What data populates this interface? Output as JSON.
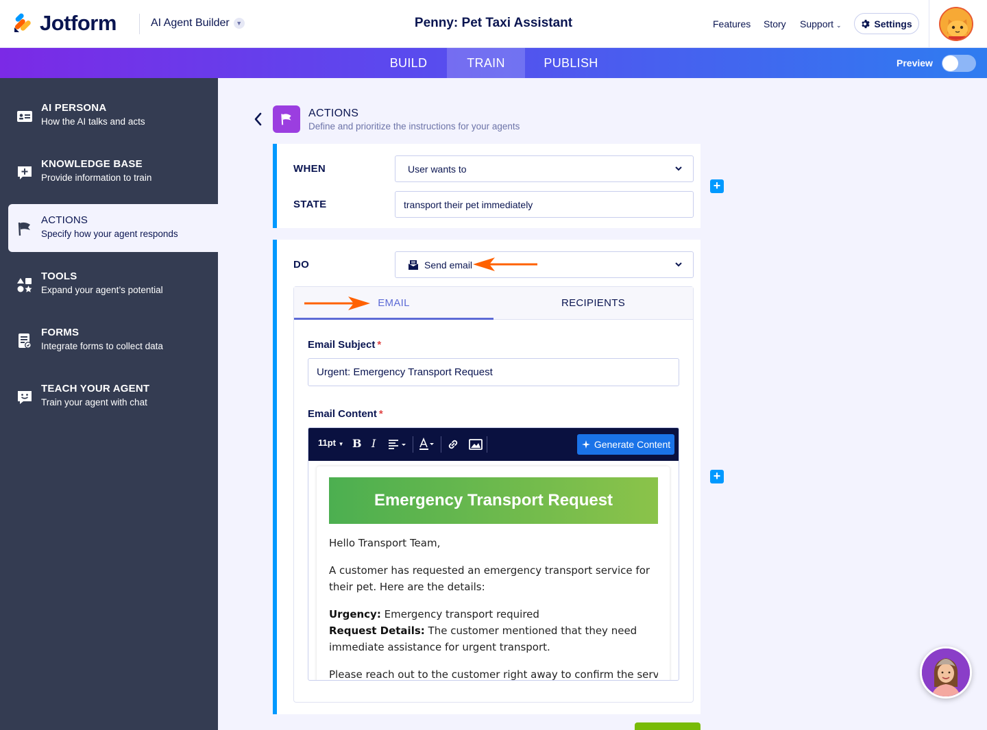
{
  "header": {
    "logo_text": "Jotform",
    "product": "AI Agent Builder",
    "agent_title": "Penny: Pet Taxi Assistant",
    "nav": [
      "Features",
      "Story",
      "Support"
    ],
    "settings_label": "Settings"
  },
  "main_tabs": [
    {
      "label": "BUILD",
      "active": false
    },
    {
      "label": "TRAIN",
      "active": true
    },
    {
      "label": "PUBLISH",
      "active": false
    }
  ],
  "preview_label": "Preview",
  "sidebar": {
    "items": [
      {
        "title": "AI PERSONA",
        "subtitle": "How the AI talks and acts",
        "icon": "persona-card-icon"
      },
      {
        "title": "KNOWLEDGE BASE",
        "subtitle": "Provide information to train",
        "icon": "knowledge-base-icon"
      },
      {
        "title": "ACTIONS",
        "subtitle": "Specify how your agent responds",
        "icon": "flag-icon",
        "active": true
      },
      {
        "title": "TOOLS",
        "subtitle": "Expand your agent’s potential",
        "icon": "tools-shapes-icon"
      },
      {
        "title": "FORMS",
        "subtitle": "Integrate forms to collect data",
        "icon": "forms-icon"
      },
      {
        "title": "TEACH YOUR AGENT",
        "subtitle": "Train your agent with chat",
        "icon": "chat-smile-icon"
      }
    ]
  },
  "page": {
    "heading": "ACTIONS",
    "subheading": "Define and prioritize the instructions for your agents"
  },
  "when_card": {
    "when_label": "WHEN",
    "when_value": "User wants to",
    "state_label": "STATE",
    "state_value": "transport their pet immediately"
  },
  "do_card": {
    "do_label": "DO",
    "do_value": "Send email",
    "tabs": [
      "EMAIL",
      "RECIPIENTS"
    ],
    "subject_label": "Email Subject",
    "subject_value": "Urgent: Emergency Transport Request",
    "content_label": "Email Content",
    "required_mark": "*",
    "toolbar": {
      "font_size": "11pt",
      "bold": "B",
      "italic": "I",
      "generate_label": "Generate Content"
    },
    "email": {
      "banner": "Emergency Transport Request",
      "greeting": "Hello Transport Team,",
      "intro": "A customer has requested an emergency transport service for their pet. Here are the details:",
      "urgency_label": "Urgency:",
      "urgency_value": "Emergency transport required",
      "details_label": "Request Details:",
      "details_value": "The customer mentioned that they need immediate assistance for urgent transport.",
      "closing": "Please reach out to the customer right away to confirm the service"
    }
  },
  "colors": {
    "accent_blue": "#0099ff",
    "sidebar_bg": "#343c52",
    "annotation_arrow": "#ff6100",
    "banner_start": "#4caf50",
    "banner_end": "#8bc34a"
  }
}
